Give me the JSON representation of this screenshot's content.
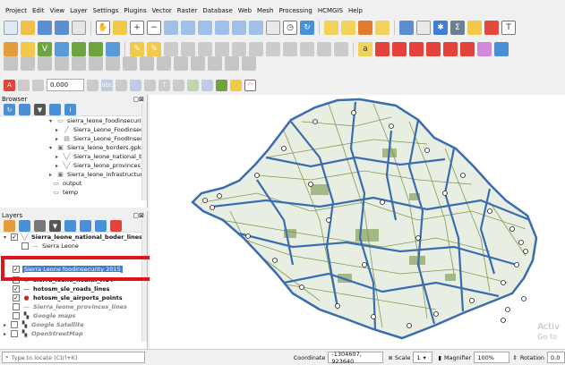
{
  "menu": [
    "Project",
    "Edit",
    "View",
    "Layer",
    "Settings",
    "Plugins",
    "Vector",
    "Raster",
    "Database",
    "Web",
    "Mesh",
    "Processing",
    "HCMGIS",
    "Help"
  ],
  "digitize": {
    "value": "0.000",
    "abc": "abc",
    "t_label": "T"
  },
  "browser": {
    "title": "Browser",
    "items": [
      "sierra_leone_foodinsecurit",
      "Sierra_Leone_Foodinsec",
      "Sierra_Leone_FoodInsec",
      "Sierra_leone_borders.gpkg",
      "Sierra_leone_national_b",
      "Sierra_leone_provinces_",
      "Sierra_leone_infrastructure",
      "output",
      "temp"
    ]
  },
  "layers": {
    "title": "Layers",
    "items": [
      "Sierra_leone_national_boder_lines",
      "Sierra Leone",
      "Sierra Leone foodinsecurity 2015",
      "sierra_leone_health_HOT",
      "hotosm_sle_roads_lines",
      "hotosm_sle_airports_points",
      "Sierra_leone_provinces_lines",
      "Google maps",
      "Google Satellite",
      "OpenStreetMap"
    ]
  },
  "status": {
    "locate_placeholder": "Type to locate (Ctrl+K)",
    "coordinate_label": "Coordinate",
    "coordinate": "-1304607, 923640",
    "scale_label": "Scale",
    "scale": "1",
    "magnifier_label": "Magnifier",
    "magnifier": "100%",
    "rotation_label": "Rotation",
    "rotation": "0.0"
  },
  "watermark": [
    "Activ",
    "Go to"
  ],
  "colors": {
    "boundary": "#3a6cb0",
    "road": "#6b8e3a",
    "highlight": "#e0151c",
    "selection": "#3d7fd6"
  }
}
